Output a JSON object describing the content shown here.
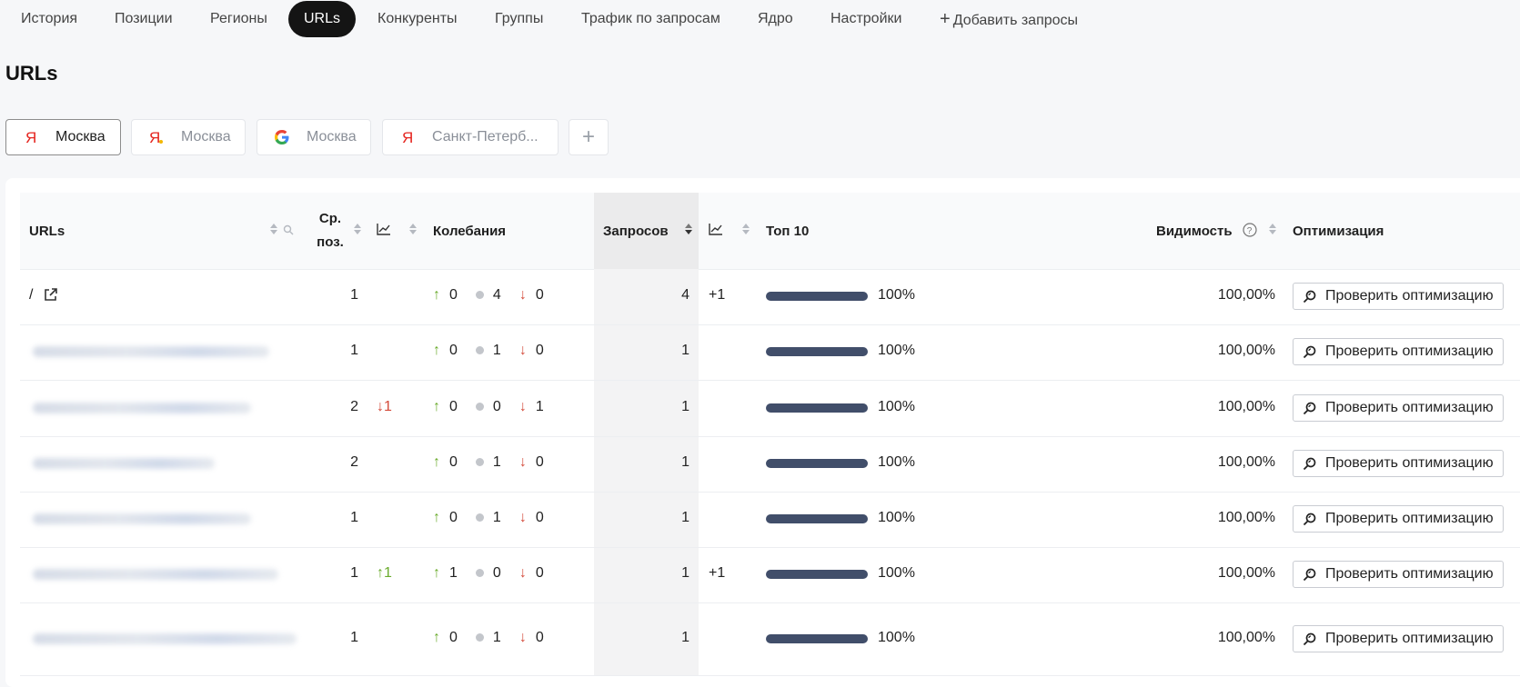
{
  "nav": {
    "items": [
      "История",
      "Позиции",
      "Регионы",
      "URLs",
      "Конкуренты",
      "Группы",
      "Трафик по запросам",
      "Ядро",
      "Настройки"
    ],
    "add_label": "Добавить запросы",
    "active": "URLs"
  },
  "page": {
    "title": "URLs"
  },
  "chips": [
    {
      "label": "Москва",
      "engine": "yandex",
      "active": true
    },
    {
      "label": "Москва",
      "engine": "yandex-dot",
      "active": false
    },
    {
      "label": "Москва",
      "engine": "google",
      "active": false
    },
    {
      "label": "Санкт-Петерб...",
      "engine": "yandex",
      "active": false
    }
  ],
  "table": {
    "headers": {
      "urls": "URLs",
      "avg_pos": "Ср. поз.",
      "fluct": "Колебания",
      "queries": "Запросов",
      "top10": "Топ 10",
      "visibility": "Видимость",
      "optimization": "Оптимизация"
    },
    "button_label": "Проверить оптимизацию",
    "rows": [
      {
        "url": "/",
        "avg_pos": "1",
        "pos_change": "",
        "up": "0",
        "same": "4",
        "down": "0",
        "queries": "4",
        "q_change": "+1",
        "top10": "100%",
        "top10_frac": 1.0,
        "visibility": "100,00%"
      },
      {
        "url": "",
        "avg_pos": "1",
        "pos_change": "",
        "up": "0",
        "same": "1",
        "down": "0",
        "queries": "1",
        "q_change": "",
        "top10": "100%",
        "top10_frac": 1.0,
        "visibility": "100,00%"
      },
      {
        "url": "",
        "avg_pos": "2",
        "pos_change": "1",
        "pos_dir": "down",
        "up": "0",
        "same": "0",
        "down": "1",
        "queries": "1",
        "q_change": "",
        "top10": "100%",
        "top10_frac": 1.0,
        "visibility": "100,00%"
      },
      {
        "url": "",
        "avg_pos": "2",
        "pos_change": "",
        "up": "0",
        "same": "1",
        "down": "0",
        "queries": "1",
        "q_change": "",
        "top10": "100%",
        "top10_frac": 1.0,
        "visibility": "100,00%"
      },
      {
        "url": "",
        "avg_pos": "1",
        "pos_change": "",
        "up": "0",
        "same": "1",
        "down": "0",
        "queries": "1",
        "q_change": "",
        "top10": "100%",
        "top10_frac": 1.0,
        "visibility": "100,00%"
      },
      {
        "url": "",
        "avg_pos": "1",
        "pos_change": "1",
        "pos_dir": "up",
        "up": "1",
        "same": "0",
        "down": "0",
        "queries": "1",
        "q_change": "+1",
        "top10": "100%",
        "top10_frac": 1.0,
        "visibility": "100,00%"
      },
      {
        "url": "",
        "avg_pos": "1",
        "pos_change": "",
        "up": "0",
        "same": "1",
        "down": "0",
        "queries": "1",
        "q_change": "",
        "top10": "100%",
        "top10_frac": 1.0,
        "visibility": "100,00%"
      }
    ]
  },
  "colors": {
    "accent": "#141414",
    "bar": "#414e6a",
    "up": "#6aab2c",
    "down": "#d44a3a"
  }
}
